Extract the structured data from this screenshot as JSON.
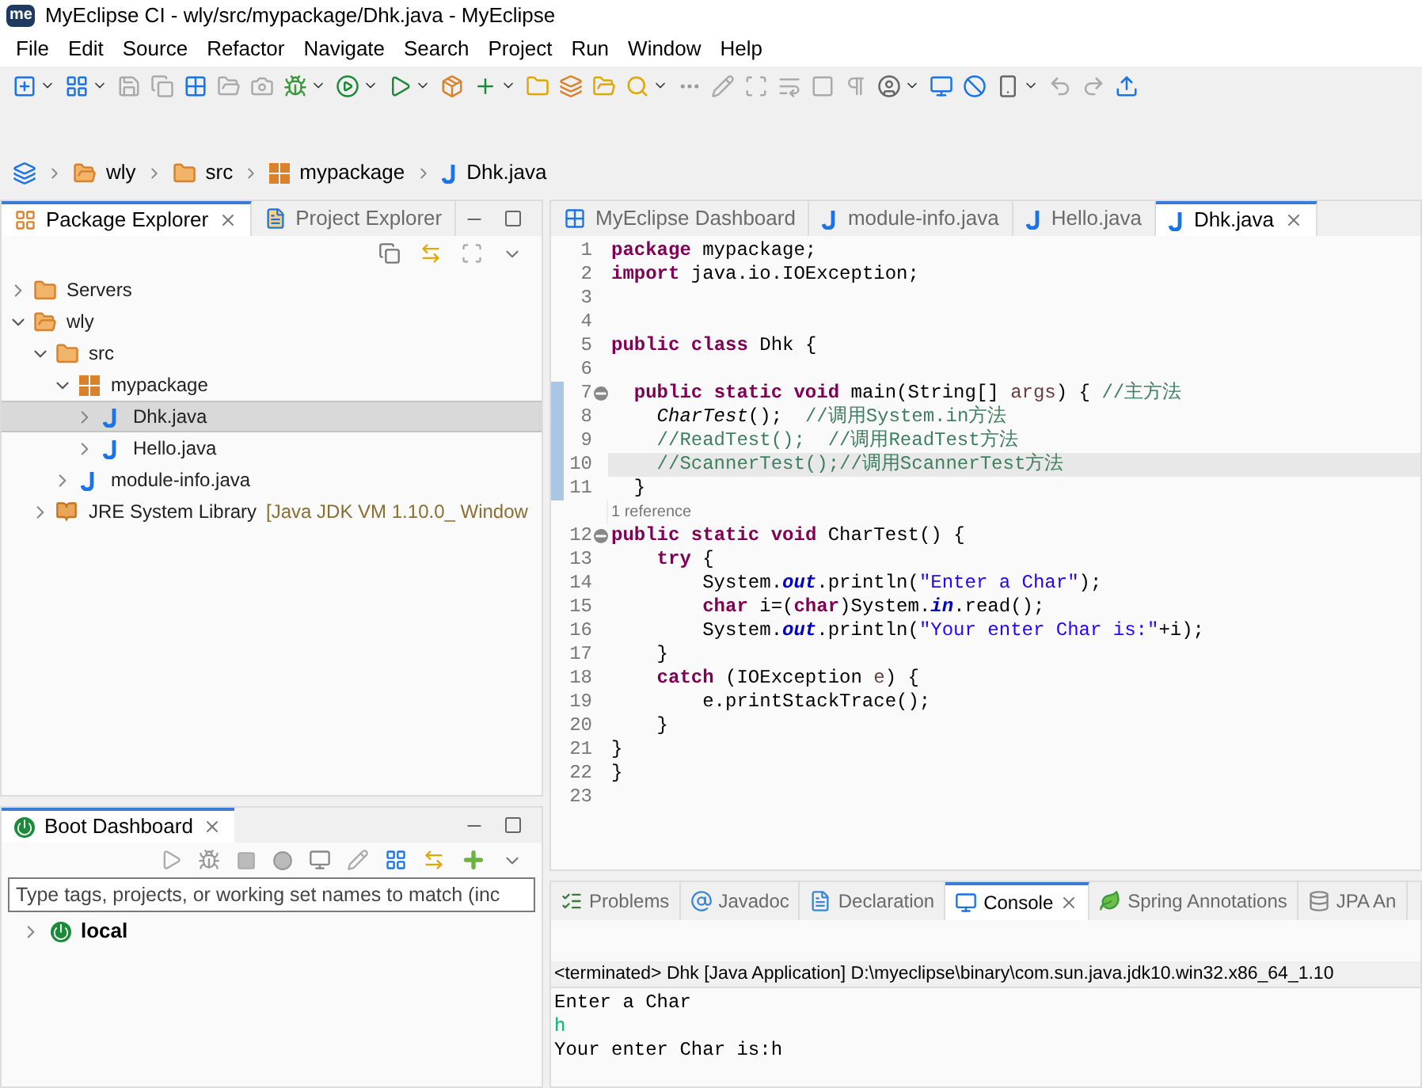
{
  "window": {
    "logo_text": "me",
    "title": "MyEclipse CI - wly/src/mypackage/Dhk.java - MyEclipse"
  },
  "menu": [
    "File",
    "Edit",
    "Source",
    "Refactor",
    "Navigate",
    "Search",
    "Project",
    "Run",
    "Window",
    "Help"
  ],
  "breadcrumb": [
    {
      "label": "wly",
      "kind": "project"
    },
    {
      "label": "src",
      "kind": "source-folder"
    },
    {
      "label": "mypackage",
      "kind": "package"
    },
    {
      "label": "Dhk.java",
      "kind": "java"
    }
  ],
  "explorer": {
    "tabs": [
      {
        "label": "Package Explorer",
        "kind": "package-explorer",
        "selected": true
      },
      {
        "label": "Project Explorer",
        "kind": "project-explorer",
        "selected": false
      }
    ],
    "tree": [
      {
        "label": "Servers",
        "kind": "folder",
        "expanded": false,
        "selected": false
      },
      {
        "label": "wly",
        "kind": "project",
        "expanded": true,
        "selected": false,
        "children": [
          {
            "label": "src",
            "kind": "source-folder",
            "expanded": true,
            "selected": false,
            "children": [
              {
                "label": "mypackage",
                "kind": "package",
                "expanded": true,
                "selected": false,
                "children": [
                  {
                    "label": "Dhk.java",
                    "kind": "java",
                    "expanded": false,
                    "selected": true
                  },
                  {
                    "label": "Hello.java",
                    "kind": "java",
                    "expanded": false,
                    "selected": false
                  }
                ]
              },
              {
                "label": "module-info.java",
                "kind": "java",
                "expanded": false,
                "selected": false
              }
            ]
          },
          {
            "label": "JRE System Library",
            "suffix": "[Java JDK VM 1.10.0_ Window",
            "kind": "library",
            "expanded": false,
            "selected": false
          }
        ]
      }
    ]
  },
  "boot_dashboard": {
    "tab": "Boot Dashboard",
    "search": {
      "placeholder": "Type tags, projects, or working set names to match (inc"
    },
    "tree": [
      {
        "label": "local",
        "expanded": false
      }
    ]
  },
  "editor": {
    "tabs": [
      {
        "label": "MyEclipse Dashboard",
        "kind": "dashboard",
        "selected": false
      },
      {
        "label": "module-info.java",
        "kind": "java",
        "selected": false
      },
      {
        "label": "Hello.java",
        "kind": "java",
        "selected": false
      },
      {
        "label": "Dhk.java",
        "kind": "java",
        "selected": true
      }
    ],
    "lines": [
      {
        "kind": "code",
        "n": "1",
        "fold": false,
        "changed": false,
        "current": false,
        "tokens": [
          {
            "kind": "keyword",
            "text": "package "
          },
          {
            "kind": "plain",
            "text": "mypackage;"
          }
        ]
      },
      {
        "kind": "code",
        "n": "2",
        "fold": false,
        "changed": false,
        "current": false,
        "tokens": [
          {
            "kind": "keyword",
            "text": "import "
          },
          {
            "kind": "plain",
            "text": "java.io.IOException;"
          }
        ]
      },
      {
        "kind": "code",
        "n": "3",
        "fold": false,
        "changed": false,
        "current": false
      },
      {
        "kind": "code",
        "n": "4",
        "fold": false,
        "changed": false,
        "current": false
      },
      {
        "kind": "code",
        "n": "5",
        "fold": false,
        "changed": false,
        "current": false,
        "tokens": [
          {
            "kind": "keyword",
            "text": "public "
          },
          {
            "kind": "keyword",
            "text": "class "
          },
          {
            "kind": "plain",
            "text": "Dhk {"
          }
        ]
      },
      {
        "kind": "code",
        "n": "6",
        "fold": false,
        "changed": false,
        "current": false
      },
      {
        "kind": "code",
        "n": "7",
        "fold": true,
        "changed": true,
        "current": false,
        "tokens": [
          {
            "kind": "keyword",
            "text": "  public "
          },
          {
            "kind": "keyword",
            "text": "static "
          },
          {
            "kind": "keyword",
            "text": "void "
          },
          {
            "kind": "plain",
            "text": "main(String[] "
          },
          {
            "kind": "parameter",
            "text": "args"
          },
          {
            "kind": "plain",
            "text": ") { "
          },
          {
            "kind": "comment",
            "text": "//主方法"
          }
        ]
      },
      {
        "kind": "code",
        "n": "8",
        "fold": false,
        "changed": true,
        "current": false,
        "tokens": [
          {
            "kind": "call",
            "text": "    CharTest"
          },
          {
            "kind": "plain",
            "text": "();  "
          },
          {
            "kind": "comment",
            "text": "//调用System.in方法"
          }
        ]
      },
      {
        "kind": "code",
        "n": "9",
        "fold": false,
        "changed": true,
        "current": false,
        "tokens": [
          {
            "kind": "comment",
            "text": "    //ReadTest();  //调用ReadTest方法"
          }
        ]
      },
      {
        "kind": "code",
        "n": "10",
        "fold": false,
        "changed": true,
        "current": true,
        "tokens": [
          {
            "kind": "comment",
            "text": "    //ScannerTest();//调用ScannerTest方法"
          }
        ]
      },
      {
        "kind": "code",
        "n": "11",
        "fold": false,
        "changed": true,
        "current": false,
        "tokens": [
          {
            "kind": "plain",
            "text": "  }"
          }
        ]
      },
      {
        "kind": "annotation",
        "text": "1 reference"
      },
      {
        "kind": "code",
        "n": "12",
        "fold": true,
        "changed": false,
        "current": false,
        "tokens": [
          {
            "kind": "keyword",
            "text": "public "
          },
          {
            "kind": "keyword",
            "text": "static "
          },
          {
            "kind": "keyword",
            "text": "void "
          },
          {
            "kind": "plain",
            "text": "CharTest() {"
          }
        ]
      },
      {
        "kind": "code",
        "n": "13",
        "fold": false,
        "changed": false,
        "current": false,
        "tokens": [
          {
            "kind": "keyword",
            "text": "    try "
          },
          {
            "kind": "plain",
            "text": "{"
          }
        ]
      },
      {
        "kind": "code",
        "n": "14",
        "fold": false,
        "changed": false,
        "current": false,
        "tokens": [
          {
            "kind": "plain",
            "text": "        System."
          },
          {
            "kind": "field",
            "text": "out"
          },
          {
            "kind": "plain",
            "text": ".println("
          },
          {
            "kind": "string",
            "text": "\"Enter a Char\""
          },
          {
            "kind": "plain",
            "text": ");"
          }
        ]
      },
      {
        "kind": "code",
        "n": "15",
        "fold": false,
        "changed": false,
        "current": false,
        "tokens": [
          {
            "kind": "keyword",
            "text": "        char "
          },
          {
            "kind": "plain",
            "text": "i=("
          },
          {
            "kind": "keyword",
            "text": "char"
          },
          {
            "kind": "plain",
            "text": ")System."
          },
          {
            "kind": "field",
            "text": "in"
          },
          {
            "kind": "plain",
            "text": ".read();"
          }
        ]
      },
      {
        "kind": "code",
        "n": "16",
        "fold": false,
        "changed": false,
        "current": false,
        "tokens": [
          {
            "kind": "plain",
            "text": "        System."
          },
          {
            "kind": "field",
            "text": "out"
          },
          {
            "kind": "plain",
            "text": ".println("
          },
          {
            "kind": "string",
            "text": "\"Your enter Char is:\""
          },
          {
            "kind": "plain",
            "text": "+i);"
          }
        ]
      },
      {
        "kind": "code",
        "n": "17",
        "fold": false,
        "changed": false,
        "current": false,
        "tokens": [
          {
            "kind": "plain",
            "text": "    }"
          }
        ]
      },
      {
        "kind": "code",
        "n": "18",
        "fold": false,
        "changed": false,
        "current": false,
        "tokens": [
          {
            "kind": "keyword",
            "text": "    catch "
          },
          {
            "kind": "plain",
            "text": "(IOException "
          },
          {
            "kind": "parameter",
            "text": "e"
          },
          {
            "kind": "plain",
            "text": ") {"
          }
        ]
      },
      {
        "kind": "code",
        "n": "19",
        "fold": false,
        "changed": false,
        "current": false,
        "tokens": [
          {
            "kind": "plain",
            "text": "        e.printStackTrace();"
          }
        ]
      },
      {
        "kind": "code",
        "n": "20",
        "fold": false,
        "changed": false,
        "current": false,
        "tokens": [
          {
            "kind": "plain",
            "text": "    }"
          }
        ]
      },
      {
        "kind": "code",
        "n": "21",
        "fold": false,
        "changed": false,
        "current": false,
        "tokens": [
          {
            "kind": "plain",
            "text": "}"
          }
        ]
      },
      {
        "kind": "code",
        "n": "22",
        "fold": false,
        "changed": false,
        "current": false,
        "tokens": [
          {
            "kind": "plain",
            "text": "}"
          }
        ]
      },
      {
        "kind": "code",
        "n": "23",
        "fold": false,
        "changed": false,
        "current": false
      }
    ]
  },
  "bottom_panel": {
    "tabs": [
      {
        "label": "Problems",
        "kind": "problems",
        "selected": false
      },
      {
        "label": "Javadoc",
        "kind": "javadoc",
        "selected": false
      },
      {
        "label": "Declaration",
        "kind": "declaration",
        "selected": false
      },
      {
        "label": "Console",
        "kind": "console",
        "selected": true
      },
      {
        "label": "Spring Annotations",
        "kind": "spring",
        "selected": false
      },
      {
        "label": "JPA An",
        "kind": "jpa",
        "selected": false
      }
    ],
    "console": {
      "header": "<terminated> Dhk [Java Application] D:\\myeclipse\\binary\\com.sun.java.jdk10.win32.x86_64_1.10",
      "lines": [
        {
          "kind": "output",
          "text": "Enter a Char"
        },
        {
          "kind": "input",
          "text": "h"
        },
        {
          "kind": "output",
          "text": "Your enter Char is:h"
        }
      ]
    }
  }
}
